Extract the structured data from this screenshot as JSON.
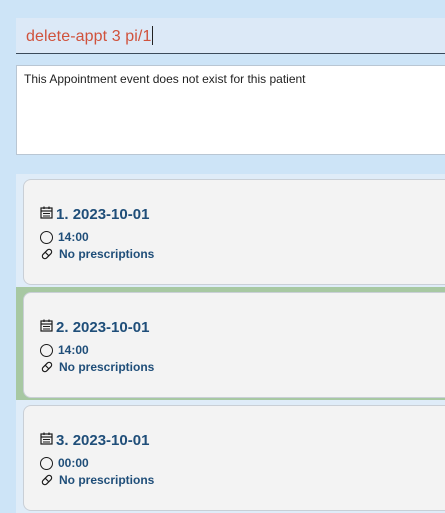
{
  "command": {
    "input_value": "delete-appt 3 pi/1"
  },
  "result": {
    "message": "This Appointment event does not exist for this patient"
  },
  "appointments": [
    {
      "index": "1.",
      "date": "2023-10-01",
      "time": "14:00",
      "prescriptions": "No prescriptions",
      "selected": false
    },
    {
      "index": "2.",
      "date": "2023-10-01",
      "time": "14:00",
      "prescriptions": "No prescriptions",
      "selected": true
    },
    {
      "index": "3.",
      "date": "2023-10-01",
      "time": "00:00",
      "prescriptions": "No prescriptions",
      "selected": false
    }
  ],
  "colors": {
    "command_text": "#d0523c",
    "card_text": "#1f4e79",
    "selected_bar": "#a7c8a2",
    "background": "#cde4f7"
  },
  "icons": {
    "date": "calendar-icon",
    "time": "clock-icon",
    "prescriptions": "pill-icon"
  }
}
